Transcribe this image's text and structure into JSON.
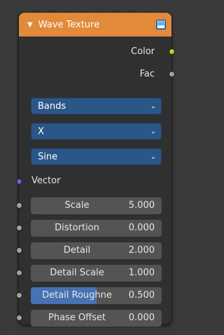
{
  "node": {
    "title": "Wave Texture",
    "header_color": "#e08a3a",
    "icons": {
      "collapse": "collapse-triangle-icon",
      "preview": "texture-preview-icon"
    }
  },
  "outputs": [
    {
      "label": "Color",
      "socket_color": "#c7c729"
    },
    {
      "label": "Fac",
      "socket_color": "#a1a1a1"
    }
  ],
  "dropdowns": [
    {
      "value": "Bands"
    },
    {
      "value": "X"
    },
    {
      "value": "Sine"
    }
  ],
  "vector_input": {
    "label": "Vector",
    "socket_color": "#6363c7"
  },
  "inputs": [
    {
      "label": "Scale",
      "value": "5.000"
    },
    {
      "label": "Distortion",
      "value": "0.000"
    },
    {
      "label": "Detail",
      "value": "2.000"
    },
    {
      "label": "Detail Scale",
      "value": "1.000"
    },
    {
      "label": "Detail Roughne",
      "value": "0.500",
      "fill_fraction": 0.5
    },
    {
      "label": "Phase Offset",
      "value": "0.000"
    }
  ],
  "colors": {
    "dropdown_bg": "#2b5688",
    "field_bg": "#545454",
    "slider_fill": "#4772b3",
    "input_socket": "#a1a1a1"
  }
}
